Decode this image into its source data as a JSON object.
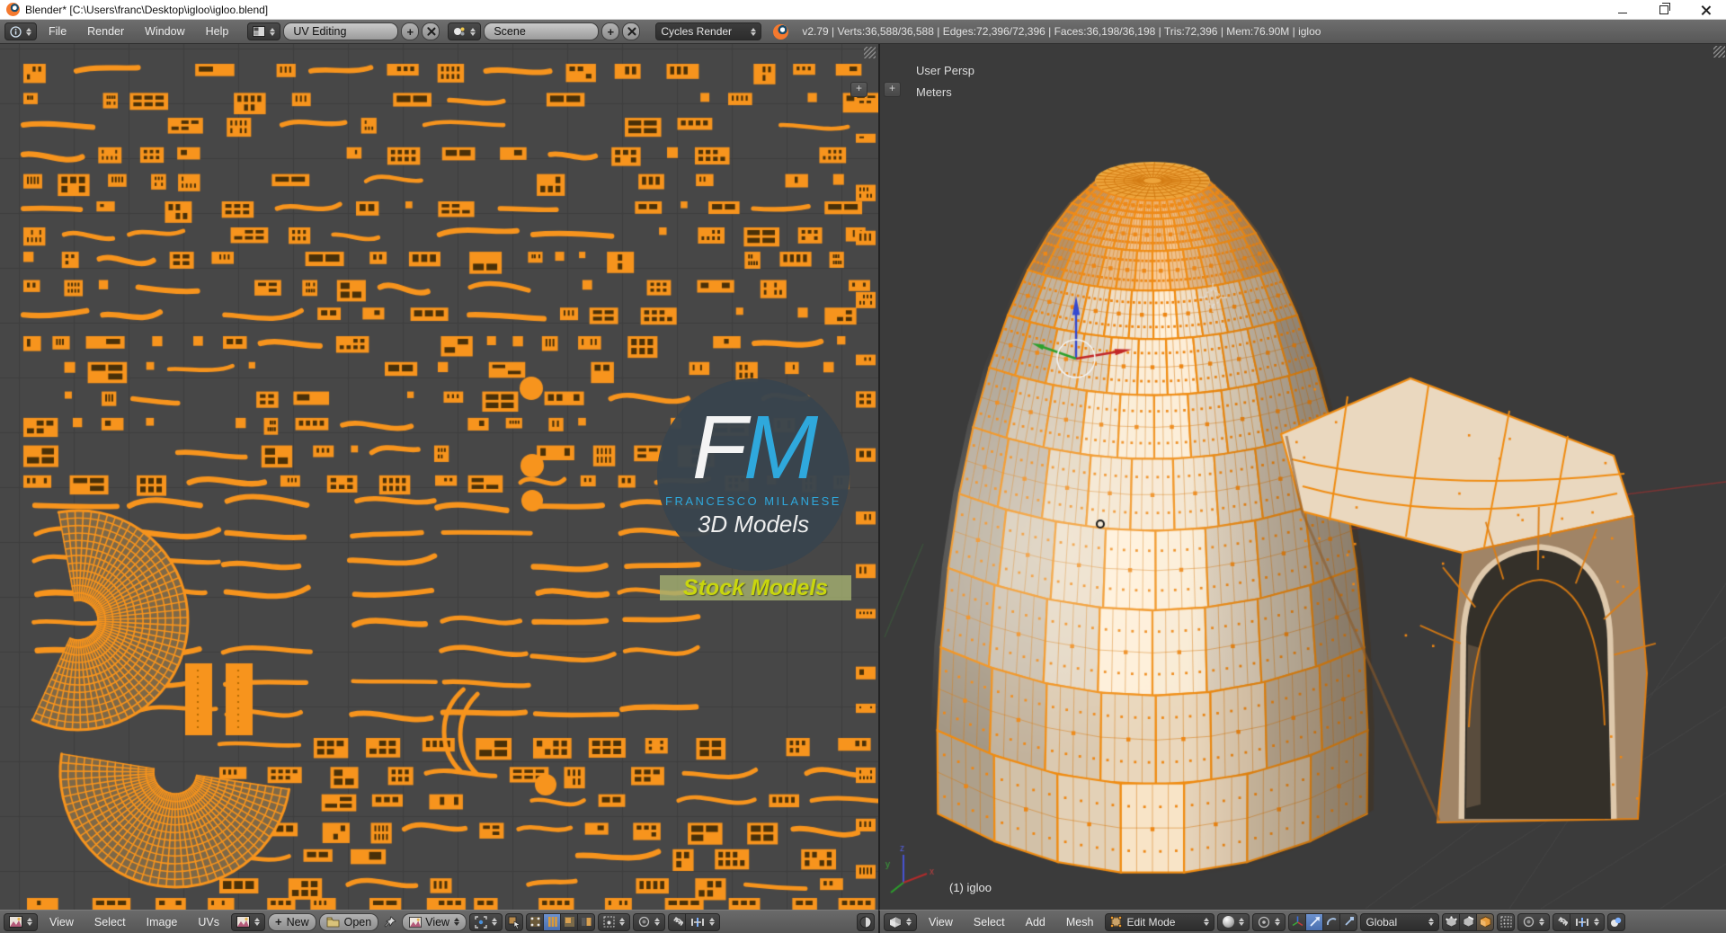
{
  "window": {
    "title": "Blender* [C:\\Users\\franc\\Desktop\\igloo\\igloo.blend]"
  },
  "info_header": {
    "menus": [
      "File",
      "Render",
      "Window",
      "Help"
    ],
    "layout_name": "UV Editing",
    "scene_name": "Scene",
    "engine": "Cycles Render",
    "stats": "v2.79 | Verts:36,588/36,588 | Edges:72,396/72,396 | Faces:36,198/36,198 | Tris:72,396 | Mem:76.90M | igloo"
  },
  "uv_editor": {
    "menus": [
      "View",
      "Select",
      "Image",
      "UVs"
    ],
    "new_label": "New",
    "open_label": "Open",
    "view_dropdown": "View",
    "logo": {
      "initial_f": "F",
      "initial_m": "M",
      "name": "FRANCESCO MILANESE",
      "subtitle": "3D Models",
      "badge": "Stock Models"
    }
  },
  "viewport_3d": {
    "overlay": {
      "view_name": "User Persp",
      "unit": "Meters",
      "object_info": "(1) igloo"
    },
    "menus": [
      "View",
      "Select",
      "Add",
      "Mesh"
    ],
    "mode": "Edit Mode",
    "orientation": "Global",
    "axis_labels": {
      "x": "x",
      "y": "y",
      "z": "z"
    }
  },
  "colors": {
    "accent_orange": "#f7941d",
    "uv_background": "#474747",
    "uv_grid": "#3e3e3e",
    "view_background": "#3b3b3b",
    "brick_light": "#f2e4cf",
    "brick_top": "#eec496",
    "wire_orange": "#f08c12",
    "logo_blue": "#2fa8dc",
    "badge_green": "#c9d60d",
    "axis_x_red": "#b32b2b",
    "axis_y_green": "#2ca02c",
    "axis_z_blue": "#4753d6"
  }
}
